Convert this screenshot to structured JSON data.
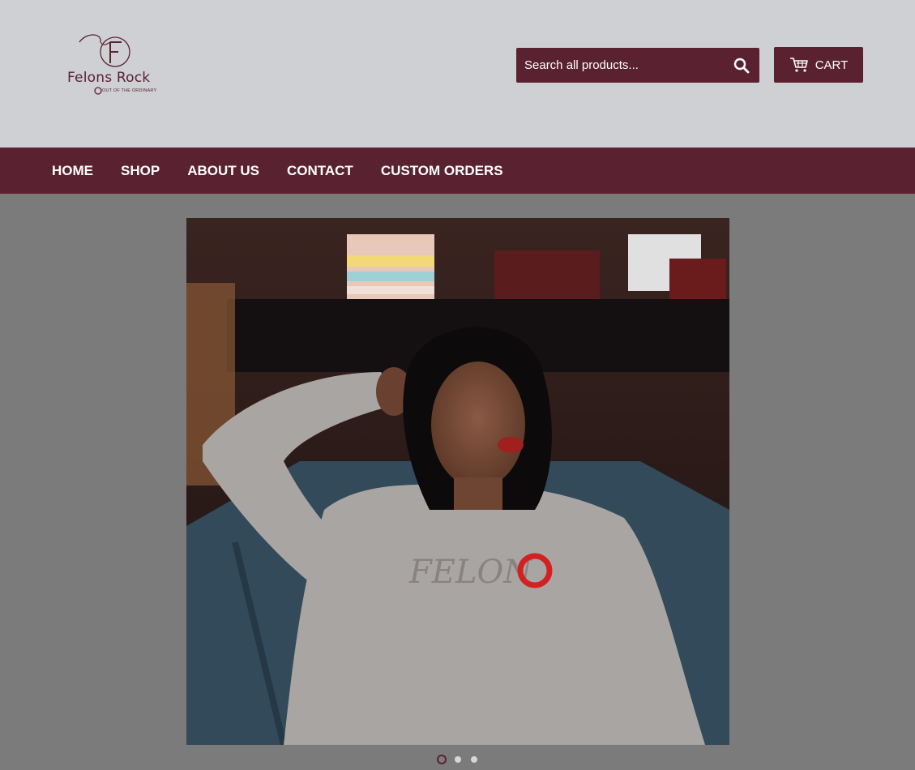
{
  "brand": {
    "name": "Felons Rock",
    "tagline": "OUT OF THE ORDINARY",
    "color": "#5a2230"
  },
  "search": {
    "placeholder": "Search all products...",
    "icon": "search-icon"
  },
  "cart": {
    "label": "CART",
    "icon": "cart-icon"
  },
  "nav": {
    "items": [
      {
        "label": "HOME"
      },
      {
        "label": "SHOP"
      },
      {
        "label": "ABOUT US"
      },
      {
        "label": "CONTACT"
      },
      {
        "label": "CUSTOM ORDERS"
      }
    ]
  },
  "slideshow": {
    "slide_count": 3,
    "active_index": 0,
    "shirt_print": "FELON"
  },
  "colors": {
    "header_bg": "#ced0d3",
    "page_bg": "#7b7b7b",
    "accent": "#5a2230"
  }
}
